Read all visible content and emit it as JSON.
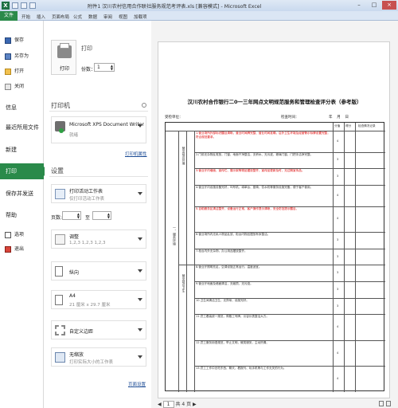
{
  "window": {
    "title": "附件1 汉川农村信用合作联社服务规范考评表.xls [兼容模式] - Microsoft Excel",
    "minimize": "–",
    "maximize": "□",
    "close": "×"
  },
  "menu": {
    "file": "文件",
    "items": [
      "开始",
      "插入",
      "页面布局",
      "公式",
      "数据",
      "审阅",
      "视图",
      "加载项"
    ]
  },
  "sidebar": {
    "save": "保存",
    "save_as": "另存为",
    "open": "打开",
    "close": "关闭",
    "info": "信息",
    "recent": "最近所用文件",
    "new": "新建",
    "print": "打印",
    "save_send": "保存并发送",
    "help": "帮助",
    "options": "选项",
    "exit": "退出"
  },
  "print_panel": {
    "title": "打印",
    "button": "打印",
    "copies_label": "份数：",
    "copies_value": "1",
    "printer_title": "打印机",
    "printer_name": "Microsoft XPS Document Writer",
    "printer_status": "就绪",
    "printer_props": "打印机属性",
    "settings_title": "设置",
    "active_sheets": "打印活动工作表",
    "active_sheets_sub": "仅打印活动工作表",
    "pages_label": "页数:",
    "pages_to": "至",
    "collated": "调整",
    "collated_sub": "1,2,3    1,2,3    1,2,3",
    "orientation": "纵向",
    "paper": "A4",
    "paper_sub": "21 厘米 x 29.7 厘米",
    "margins": "自定义边距",
    "scaling": "无缩放",
    "scaling_sub": "打印实际大小的工作表",
    "page_setup": "页面设置"
  },
  "preview": {
    "doc_title": "汉川农村合作银行二0一三年网点文明规范服务和管理检查评分表（参考版）",
    "unit_label": "受检单位：",
    "checker_label": "检查时间：",
    "date_label": "年    月    日",
    "col_score": "分值",
    "col_points": "得分",
    "col_notes": "检查情况记录",
    "section_1": "一、服务环境",
    "sub_1": "营业网点环境",
    "sub_2": "营业网点卫生",
    "rows": [
      "1.营业场所外部标识醒目清晰，营业时间牌完整、营业时间准确，店外卫生环境及经营警示标牌设置完整，符合规范要求。",
      "2.门前无杂物乱堆放，门窗、地面干净整洁，无积水、无污迹，玻璃门窗、门把手洁净完整。",
      "3.营业厅内墙面、宣传栏、展示架等物品摆放整齐，宣传品更新及时，无过期宣传品。",
      "4.营业厅内设施设备完好，叫号机、填单台、座椅、饮水机等服务设施完备，便于客户使用。",
      "5.自助服务区清洁整齐，设备运行正常，客户操作提示清晰，安全防范提示醒目。",
      "6.营业场所内无私人物品乱放，柜台内物品摆放有序整洁。",
      "7.柜台内外无杂物，办公用品摆放整齐。",
      "8.营业厅照明充足，空调设施正常运行，温度适宜。",
      "9.营业厅地面及墙面清洁，无破损、无污迹。",
      "10.卫生间清洁卫生，无异味，设施完好。",
      "11.员工着装统一规范，佩戴工号牌，仪容仪表整洁大方。",
      "12.员工服务用语规范，举止文明，微笑服务，主动热情。",
      "13.员工工作中无吃东西、聊天、看报刊、玩手机等与工作无关的行为。"
    ],
    "score_values": [
      "4",
      "3",
      "3",
      "4",
      "4",
      "3",
      "3",
      "3",
      "3",
      "3",
      "4",
      "4",
      "4"
    ],
    "page_current": "1",
    "page_total_label": "共 4 页"
  },
  "colors": {
    "file_green": "#2a8a4a",
    "titlebar": "#dfe9f5",
    "close_red": "#c75050"
  }
}
